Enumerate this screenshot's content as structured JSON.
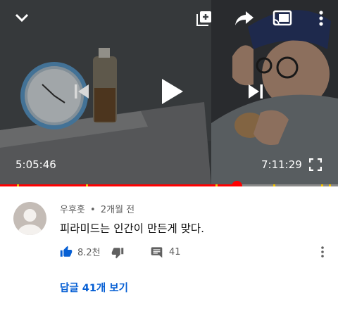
{
  "player": {
    "current_time": "5:05:46",
    "duration": "7:11:29",
    "progress_fraction": 0.7,
    "icons": {
      "collapse": "chevron-down-icon",
      "add_to_playlist": "playlist-add-icon",
      "share": "share-icon",
      "cast": "cast-icon",
      "more": "more-vert-icon",
      "previous": "skip-previous-icon",
      "play": "play-icon",
      "next": "skip-next-icon",
      "fullscreen": "fullscreen-icon"
    },
    "colors": {
      "progress": "#ff0000",
      "ad_marker": "#f2c200"
    }
  },
  "comment": {
    "author": "우후훗",
    "separator": "•",
    "time_ago": "2개월 전",
    "text": "피라미드는 인간이 만든게 맞다.",
    "likes": "8.2천",
    "reply_count": "41",
    "view_replies": "답글 41개 보기",
    "colors": {
      "like_active": "#065fd4",
      "link": "#065fd4"
    }
  }
}
